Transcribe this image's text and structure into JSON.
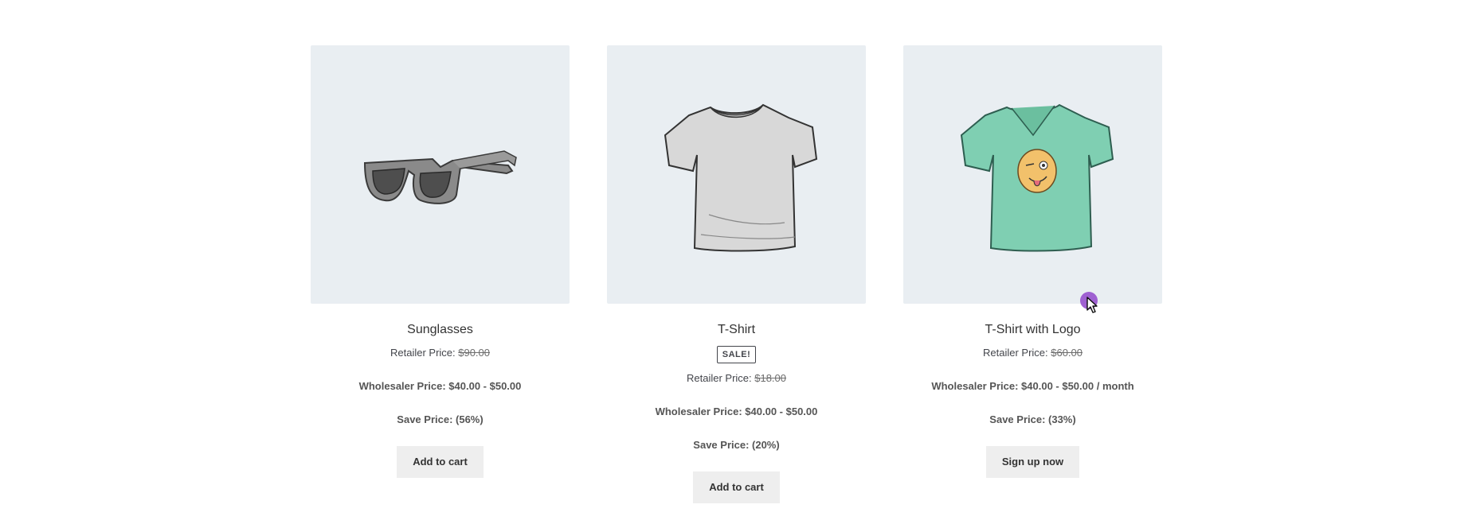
{
  "products": [
    {
      "title": "Sunglasses",
      "badge": "",
      "retail_label": "Retailer Price: ",
      "retail_price": "$90.00",
      "wholesale": "Wholesaler Price: $40.00 - $50.00",
      "save": "Save Price: (56%)",
      "button": "Add to cart",
      "image": "sunglasses-icon"
    },
    {
      "title": "T-Shirt",
      "badge": "SALE!",
      "retail_label": "Retailer Price: ",
      "retail_price": "$18.00",
      "wholesale": "Wholesaler Price: $40.00 - $50.00",
      "save": "Save Price: (20%)",
      "button": "Add to cart",
      "image": "tshirt-icon"
    },
    {
      "title": "T-Shirt with Logo",
      "badge": "",
      "retail_label": "Retailer Price: ",
      "retail_price": "$60.00",
      "wholesale": "Wholesaler Price: $40.00 - $50.00 / month",
      "save": "Save Price: (33%)",
      "button": "Sign up now",
      "image": "tshirt-logo-icon"
    }
  ],
  "colors": {
    "image_bg": "#e9eef2",
    "button_bg": "#eeeeee",
    "tshirt_logo": "#7fcfb2",
    "cursor": "#9b59d0"
  }
}
